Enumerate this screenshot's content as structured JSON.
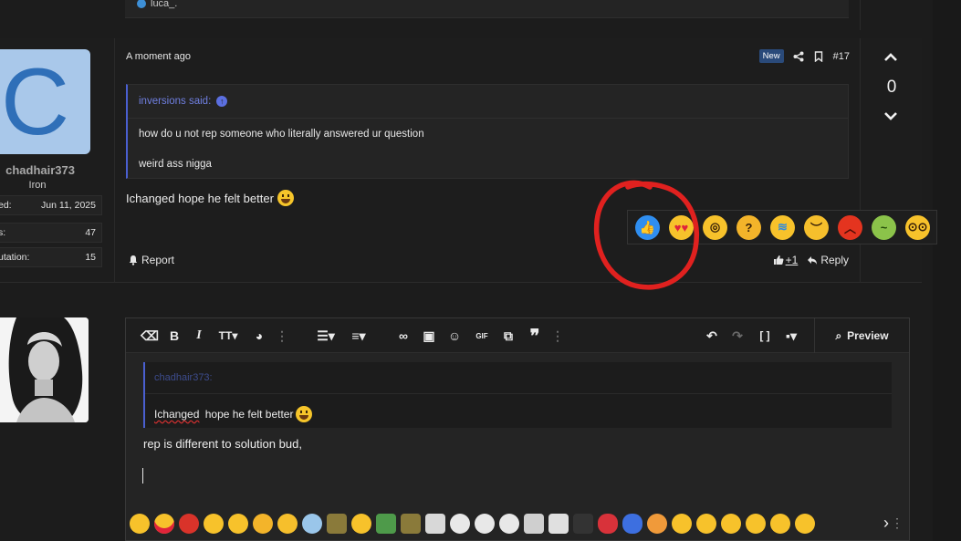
{
  "previous_post": {
    "user": "luca_."
  },
  "post": {
    "time": "A moment ago",
    "badge_new": "New",
    "number": "#17",
    "author": {
      "avatar_letter": "C",
      "username": "chadhair373",
      "rank": "Iron",
      "stats": [
        {
          "label": "ed:",
          "value": "Jun 11, 2025"
        },
        {
          "label": "s:",
          "value": "47"
        },
        {
          "label": "utation:",
          "value": "15"
        }
      ]
    },
    "quote": {
      "author": "inversions said:",
      "lines": [
        "how do u not rep someone who literally answered ur question",
        "weird ass nigga"
      ]
    },
    "body": "Ichanged hope he felt better",
    "actions": {
      "report": "Report",
      "plus_one": "+1",
      "reply": "Reply"
    },
    "vote_count": "0",
    "reactions": [
      "like",
      "love-eyes",
      "wow",
      "thinking",
      "cry-laugh",
      "sad",
      "angry",
      "sick",
      "nerd"
    ]
  },
  "editor": {
    "preview_label": "Preview",
    "quote_author": "chadhair373:",
    "quote_body": "Ichanged hope he felt better",
    "quote_body_misspelled": "Ichanged",
    "quote_body_rest": " hope he felt better",
    "text": "rep is different to solution bud,",
    "toolbar_icons": [
      "eraser-icon",
      "bold-icon",
      "italic-icon",
      "text-size-icon",
      "palette-icon",
      "more-icon",
      "list-icon",
      "align-icon",
      "link-icon",
      "image-icon",
      "smilie-icon",
      "gif-icon",
      "media-icon",
      "quote-icon",
      "more-icon",
      "undo-icon",
      "redo-icon",
      "bbcode-icon",
      "save-draft-icon"
    ]
  },
  "colors": {
    "accent_blue": "#4a5fd0",
    "annotation_red": "#e0211f",
    "badge_new_bg": "#2a4a7a"
  }
}
